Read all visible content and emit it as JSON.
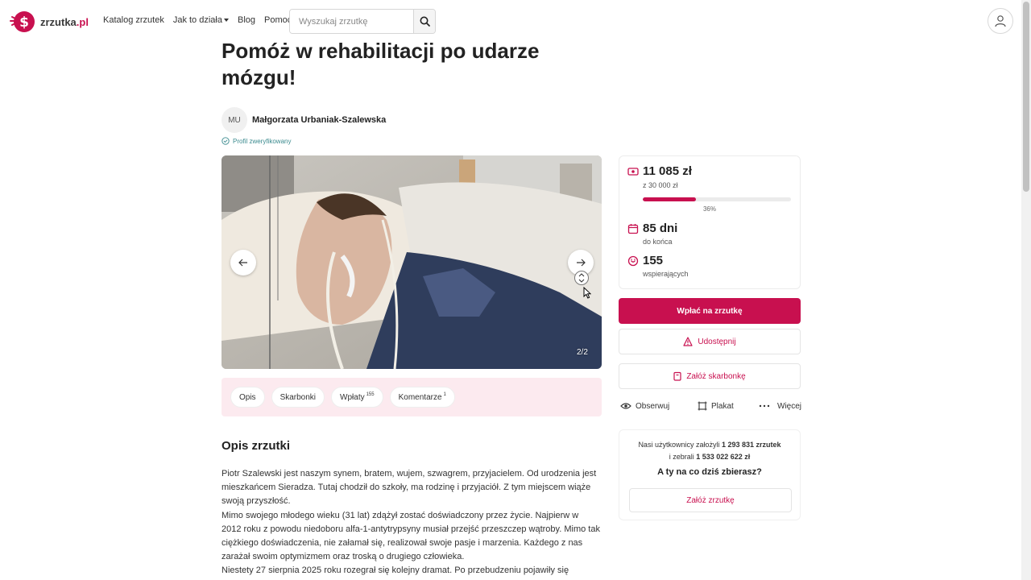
{
  "brand": {
    "name": "zrzutka",
    "tld": ".pl",
    "accent": "#c8104f"
  },
  "nav": {
    "items": [
      "Katalog zrzutek",
      "Jak to działa",
      "Blog",
      "Pomoc"
    ]
  },
  "search": {
    "placeholder": "Wyszukaj zrzutkę"
  },
  "campaign": {
    "title": "Pomóż w rehabilitacji po udarze mózgu!",
    "author_initials": "MU",
    "author_name": "Małgorzata Urbaniak-Szalewska",
    "verified_label": "Profil zweryfikowany"
  },
  "gallery": {
    "counter": "2/2",
    "current": 2,
    "total": 2
  },
  "tabs": [
    {
      "label": "Opis",
      "count": ""
    },
    {
      "label": "Skarbonki",
      "count": ""
    },
    {
      "label": "Wpłaty",
      "count": "155"
    },
    {
      "label": "Komentarze",
      "count": "1"
    }
  ],
  "description": {
    "title": "Opis zrzutki",
    "paragraphs": [
      "Piotr Szalewski jest naszym synem, bratem, wujem, szwagrem, przyjacielem. Od urodzenia jest mieszkańcem Sieradza. Tutaj chodził do szkoły, ma rodzinę i przyjaciół. Z tym miejscem wiąże swoją przyszłość.",
      "Mimo swojego młodego wieku (31 lat) zdążył zostać doświadczony przez życie. Najpierw w 2012 roku z powodu niedoboru alfa-1-antytrypsyny musiał przejść przeszczep wątroby. Mimo tak ciężkiego doświadczenia, nie załamał się, realizował swoje pasje i marzenia. Każdego z nas zarażał swoim optymizmem oraz troską o drugiego człowieka.",
      "Niestety 27 sierpnia 2025 roku rozegrał się kolejny dramat. Po przebudzeniu pojawiły się"
    ]
  },
  "stats": {
    "raised": "11 085 zł",
    "goal": "z 30 000 zł",
    "percent": 36,
    "percent_label": "36%",
    "days": "85 dni",
    "days_label": "do końca",
    "supporters": "155",
    "supporters_label": "wspierających"
  },
  "buttons": {
    "donate": "Wpłać na zrzutkę",
    "share": "Udostępnij",
    "piggy": "Załóż skarbonkę"
  },
  "actions": {
    "follow": "Obserwuj",
    "poster": "Plakat",
    "more": "Więcej"
  },
  "promo": {
    "line1_prefix": "Nasi użytkownicy założyli",
    "line1_count": "1 293 831",
    "line1_suffix": "zrzutek",
    "line2_prefix": "i zebrali",
    "line2_amount": "1 533 022 622 zł",
    "question": "A ty na co dziś zbierasz?",
    "button": "Załóż zrzutkę"
  }
}
